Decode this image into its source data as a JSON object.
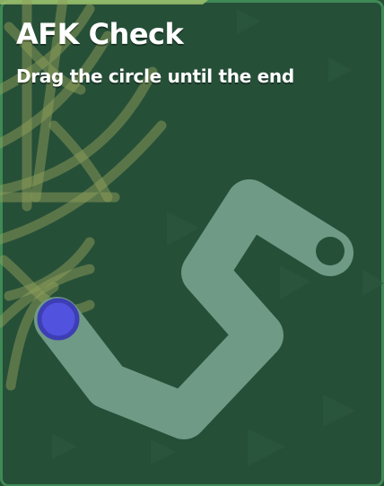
{
  "dialog": {
    "title": "AFK Check",
    "instruction": "Drag the circle until the end"
  },
  "colors": {
    "background": "#264f38",
    "panel_border": "#3f8a56",
    "path": "#6f9a86",
    "handle_fill": "#5152de",
    "handle_stroke": "#3d3eb4",
    "web": "#8e9e5a",
    "top_strip": "#9fbf6c"
  },
  "handle": {
    "name": "drag-circle",
    "progress": 0
  }
}
